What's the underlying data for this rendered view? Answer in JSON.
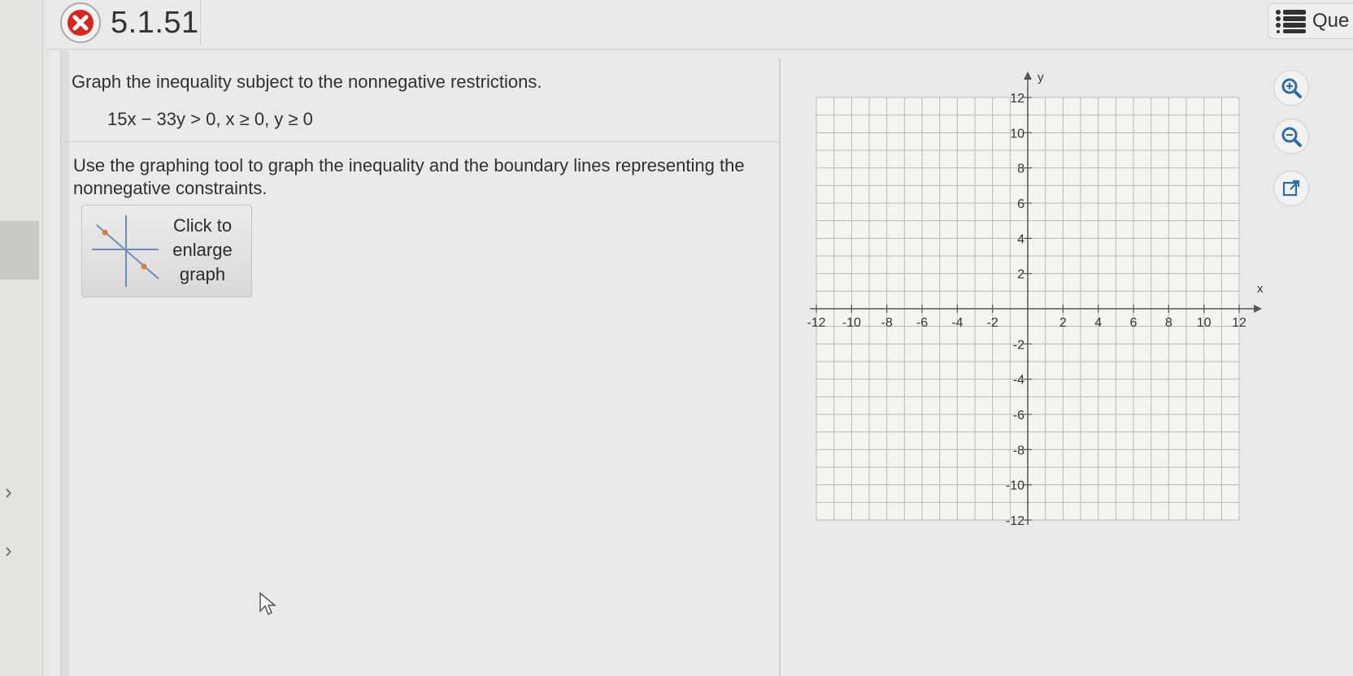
{
  "header": {
    "question_number": "5.1.51",
    "status_icon": "x-mark-icon",
    "question_list_label": "Que",
    "question_list_icon": "list-icon"
  },
  "question": {
    "instruction": "Graph the inequality subject to the nonnegative restrictions.",
    "equation": "15x − 33y > 0, x ≥ 0, y ≥ 0",
    "tool_instruction": "Use the graphing tool to graph the inequality and the boundary lines representing the nonnegative constraints.",
    "enlarge_button": {
      "line1": "Click to",
      "line2": "enlarge",
      "line3": "graph"
    }
  },
  "side_tools": [
    "zoom-in-icon",
    "zoom-out-icon",
    "open-external-icon"
  ],
  "colors": {
    "wrong": "#d9261c",
    "grid": "#b9b9b9",
    "axis": "#555555",
    "tool_icon": "#2e6da4"
  },
  "chart_data": {
    "type": "coordinate-grid",
    "x_label": "x",
    "y_label": "y",
    "xlim": [
      -12,
      12
    ],
    "ylim": [
      -12,
      12
    ],
    "grid": true,
    "grid_step": 1,
    "x_tick_labels": [
      "-12",
      "-10",
      "-8",
      "-6",
      "-4",
      "-2",
      "2",
      "4",
      "6",
      "8",
      "10",
      "12"
    ],
    "y_tick_labels": [
      "12",
      "10",
      "8",
      "6",
      "4",
      "2",
      "-2",
      "-4",
      "-6",
      "-8",
      "-10",
      "-12"
    ]
  }
}
